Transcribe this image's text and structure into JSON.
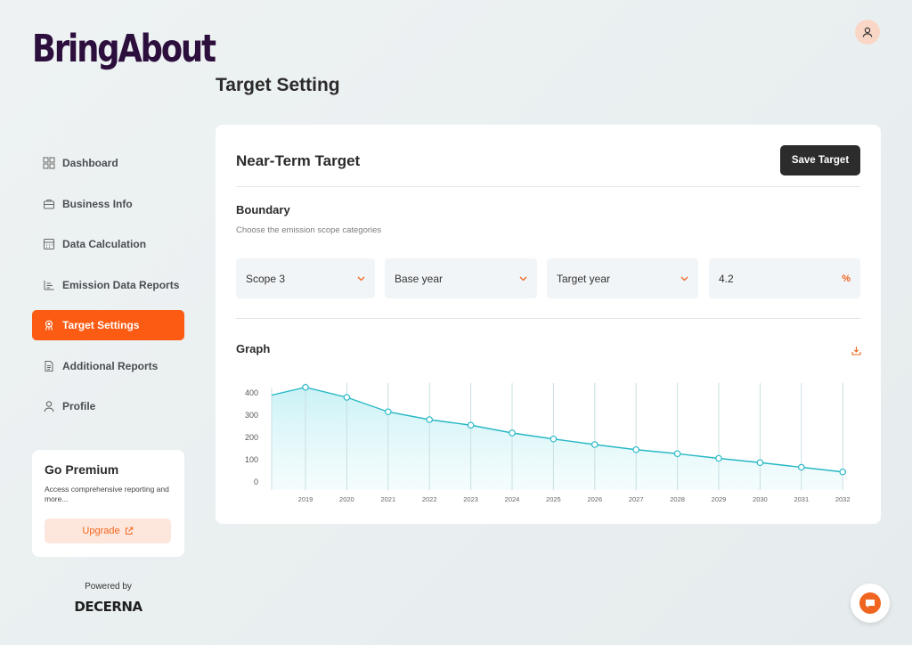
{
  "brand": {
    "logo_text": "BringAbout"
  },
  "header": {
    "title": "Target Setting"
  },
  "sidebar": {
    "items": [
      {
        "label": "Dashboard",
        "icon": "dashboard-icon"
      },
      {
        "label": "Business Info",
        "icon": "business-icon"
      },
      {
        "label": "Data Calculation",
        "icon": "calculator-icon"
      },
      {
        "label": "Emission Data Reports",
        "icon": "report-icon"
      },
      {
        "label": "Target Settings",
        "icon": "target-icon",
        "active": true
      },
      {
        "label": "Additional Reports",
        "icon": "document-icon"
      },
      {
        "label": "Profile",
        "icon": "user-icon"
      }
    ]
  },
  "premium": {
    "title": "Go Premium",
    "text": "Access comprehensive reporting and more...",
    "button": "Upgrade"
  },
  "footer": {
    "powered_label": "Powered by",
    "powered_brand": "DECERNA"
  },
  "card": {
    "title": "Near-Term Target",
    "save_label": "Save Target",
    "boundary": {
      "title": "Boundary",
      "subtitle": "Choose the emission scope categories",
      "scope": "Scope 3",
      "base_year": "Base year",
      "target_year": "Target year",
      "rate": "4.2",
      "rate_unit": "%"
    },
    "graph_title": "Graph"
  },
  "colors": {
    "accent": "#fb5b12",
    "line": "#27b8c4",
    "dark": "#2c2c2c"
  },
  "chart_data": {
    "type": "area",
    "x": [
      "2019",
      "2020",
      "2021",
      "2022",
      "2023",
      "2024",
      "2025",
      "2026",
      "2027",
      "2028",
      "2029",
      "2030",
      "2031",
      "2032"
    ],
    "values": [
      425,
      380,
      315,
      280,
      255,
      220,
      193,
      168,
      145,
      127,
      106,
      87,
      66,
      45
    ],
    "start_value": 390,
    "yticks": [
      0,
      100,
      200,
      300,
      400
    ],
    "ylim": [
      0,
      450
    ],
    "grid": "vertical"
  }
}
